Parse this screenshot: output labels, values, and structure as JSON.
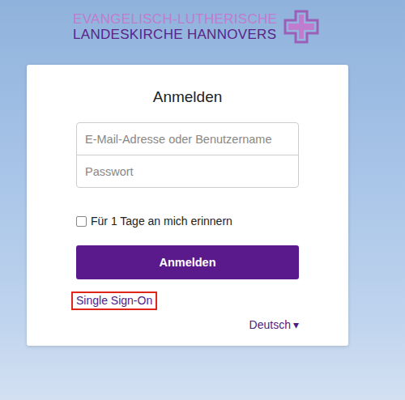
{
  "header": {
    "logo_line1": "EVANGELISCH-LUTHERISCHE",
    "logo_line2": "LANDESKIRCHE HANNOVERS"
  },
  "login": {
    "title": "Anmelden",
    "fields": [
      {
        "placeholder": "E-Mail-Adresse oder Benutzername",
        "kind": "text"
      },
      {
        "placeholder": "Passwort",
        "kind": "password"
      }
    ],
    "remember": {
      "label": "Für 1 Tage an mich erinnern",
      "checked": false
    },
    "submit": "Anmelden",
    "sso": {
      "label": "Single Sign-On",
      "highlighted": true
    },
    "language": {
      "label": "Deutsch",
      "caret": "▾"
    }
  }
}
